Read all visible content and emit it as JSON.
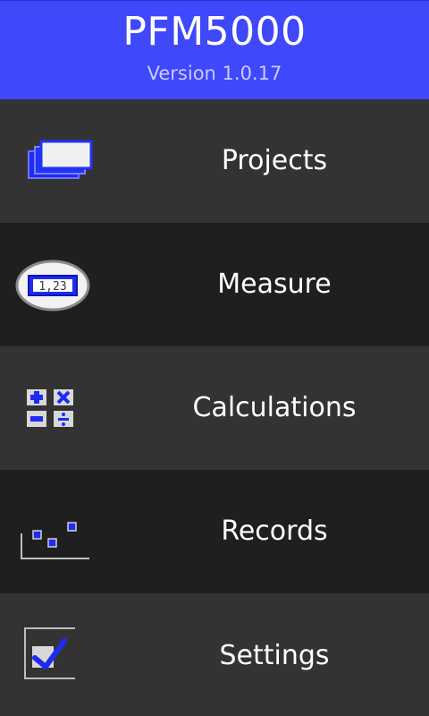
{
  "header": {
    "title": "PFM5000",
    "version": "Version 1.0.17"
  },
  "menu": [
    {
      "label": "Projects",
      "icon": "projects-icon"
    },
    {
      "label": "Measure",
      "icon": "measure-icon",
      "display_value": "1,23"
    },
    {
      "label": "Calculations",
      "icon": "calculations-icon"
    },
    {
      "label": "Records",
      "icon": "records-icon"
    },
    {
      "label": "Settings",
      "icon": "settings-icon"
    }
  ],
  "colors": {
    "header_bg": "#3f48fa",
    "accent": "#1f2bf2",
    "row_light": "#333333",
    "row_dark": "#1f1f1f"
  }
}
